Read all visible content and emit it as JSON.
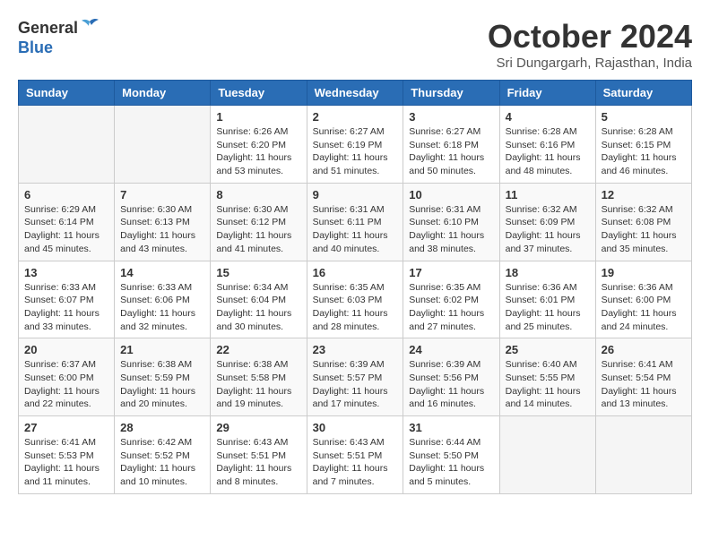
{
  "header": {
    "logo_general": "General",
    "logo_blue": "Blue",
    "month_title": "October 2024",
    "location": "Sri Dungargarh, Rajasthan, India"
  },
  "weekdays": [
    "Sunday",
    "Monday",
    "Tuesday",
    "Wednesday",
    "Thursday",
    "Friday",
    "Saturday"
  ],
  "weeks": [
    [
      {
        "day": "",
        "info": ""
      },
      {
        "day": "",
        "info": ""
      },
      {
        "day": "1",
        "info": "Sunrise: 6:26 AM\nSunset: 6:20 PM\nDaylight: 11 hours and 53 minutes."
      },
      {
        "day": "2",
        "info": "Sunrise: 6:27 AM\nSunset: 6:19 PM\nDaylight: 11 hours and 51 minutes."
      },
      {
        "day": "3",
        "info": "Sunrise: 6:27 AM\nSunset: 6:18 PM\nDaylight: 11 hours and 50 minutes."
      },
      {
        "day": "4",
        "info": "Sunrise: 6:28 AM\nSunset: 6:16 PM\nDaylight: 11 hours and 48 minutes."
      },
      {
        "day": "5",
        "info": "Sunrise: 6:28 AM\nSunset: 6:15 PM\nDaylight: 11 hours and 46 minutes."
      }
    ],
    [
      {
        "day": "6",
        "info": "Sunrise: 6:29 AM\nSunset: 6:14 PM\nDaylight: 11 hours and 45 minutes."
      },
      {
        "day": "7",
        "info": "Sunrise: 6:30 AM\nSunset: 6:13 PM\nDaylight: 11 hours and 43 minutes."
      },
      {
        "day": "8",
        "info": "Sunrise: 6:30 AM\nSunset: 6:12 PM\nDaylight: 11 hours and 41 minutes."
      },
      {
        "day": "9",
        "info": "Sunrise: 6:31 AM\nSunset: 6:11 PM\nDaylight: 11 hours and 40 minutes."
      },
      {
        "day": "10",
        "info": "Sunrise: 6:31 AM\nSunset: 6:10 PM\nDaylight: 11 hours and 38 minutes."
      },
      {
        "day": "11",
        "info": "Sunrise: 6:32 AM\nSunset: 6:09 PM\nDaylight: 11 hours and 37 minutes."
      },
      {
        "day": "12",
        "info": "Sunrise: 6:32 AM\nSunset: 6:08 PM\nDaylight: 11 hours and 35 minutes."
      }
    ],
    [
      {
        "day": "13",
        "info": "Sunrise: 6:33 AM\nSunset: 6:07 PM\nDaylight: 11 hours and 33 minutes."
      },
      {
        "day": "14",
        "info": "Sunrise: 6:33 AM\nSunset: 6:06 PM\nDaylight: 11 hours and 32 minutes."
      },
      {
        "day": "15",
        "info": "Sunrise: 6:34 AM\nSunset: 6:04 PM\nDaylight: 11 hours and 30 minutes."
      },
      {
        "day": "16",
        "info": "Sunrise: 6:35 AM\nSunset: 6:03 PM\nDaylight: 11 hours and 28 minutes."
      },
      {
        "day": "17",
        "info": "Sunrise: 6:35 AM\nSunset: 6:02 PM\nDaylight: 11 hours and 27 minutes."
      },
      {
        "day": "18",
        "info": "Sunrise: 6:36 AM\nSunset: 6:01 PM\nDaylight: 11 hours and 25 minutes."
      },
      {
        "day": "19",
        "info": "Sunrise: 6:36 AM\nSunset: 6:00 PM\nDaylight: 11 hours and 24 minutes."
      }
    ],
    [
      {
        "day": "20",
        "info": "Sunrise: 6:37 AM\nSunset: 6:00 PM\nDaylight: 11 hours and 22 minutes."
      },
      {
        "day": "21",
        "info": "Sunrise: 6:38 AM\nSunset: 5:59 PM\nDaylight: 11 hours and 20 minutes."
      },
      {
        "day": "22",
        "info": "Sunrise: 6:38 AM\nSunset: 5:58 PM\nDaylight: 11 hours and 19 minutes."
      },
      {
        "day": "23",
        "info": "Sunrise: 6:39 AM\nSunset: 5:57 PM\nDaylight: 11 hours and 17 minutes."
      },
      {
        "day": "24",
        "info": "Sunrise: 6:39 AM\nSunset: 5:56 PM\nDaylight: 11 hours and 16 minutes."
      },
      {
        "day": "25",
        "info": "Sunrise: 6:40 AM\nSunset: 5:55 PM\nDaylight: 11 hours and 14 minutes."
      },
      {
        "day": "26",
        "info": "Sunrise: 6:41 AM\nSunset: 5:54 PM\nDaylight: 11 hours and 13 minutes."
      }
    ],
    [
      {
        "day": "27",
        "info": "Sunrise: 6:41 AM\nSunset: 5:53 PM\nDaylight: 11 hours and 11 minutes."
      },
      {
        "day": "28",
        "info": "Sunrise: 6:42 AM\nSunset: 5:52 PM\nDaylight: 11 hours and 10 minutes."
      },
      {
        "day": "29",
        "info": "Sunrise: 6:43 AM\nSunset: 5:51 PM\nDaylight: 11 hours and 8 minutes."
      },
      {
        "day": "30",
        "info": "Sunrise: 6:43 AM\nSunset: 5:51 PM\nDaylight: 11 hours and 7 minutes."
      },
      {
        "day": "31",
        "info": "Sunrise: 6:44 AM\nSunset: 5:50 PM\nDaylight: 11 hours and 5 minutes."
      },
      {
        "day": "",
        "info": ""
      },
      {
        "day": "",
        "info": ""
      }
    ]
  ]
}
